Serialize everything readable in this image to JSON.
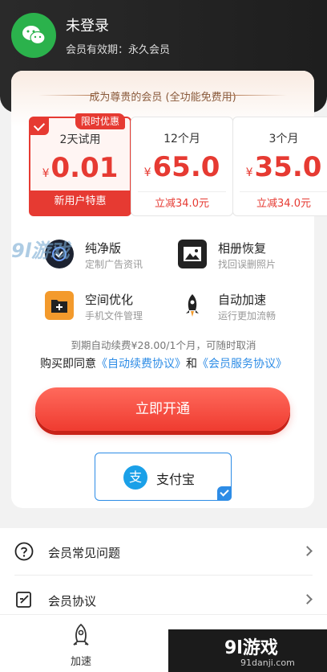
{
  "header": {
    "user_name": "未登录",
    "membership": "会员有效期：永久会员"
  },
  "card": {
    "title": "成为尊贵的会员 (全功能免费用)"
  },
  "plans": [
    {
      "name": "2天试用",
      "currency": "¥",
      "price": "0.01",
      "foot": "新用户特惠",
      "badge": "限时优惠",
      "selected": true
    },
    {
      "name": "12个月",
      "currency": "¥",
      "price": "65.0",
      "foot": "立减34.0元",
      "selected": false
    },
    {
      "name": "3个月",
      "currency": "¥",
      "price": "35.0",
      "foot": "立减34.0元",
      "selected": false
    }
  ],
  "features": [
    {
      "title": "纯净版",
      "desc": "定制广告资讯",
      "icon": "pure-icon"
    },
    {
      "title": "相册恢复",
      "desc": "找回误删照片",
      "icon": "photo-icon"
    },
    {
      "title": "空间优化",
      "desc": "手机文件管理",
      "icon": "folder-plus-icon"
    },
    {
      "title": "自动加速",
      "desc": "运行更加流畅",
      "icon": "rocket-icon"
    }
  ],
  "renew": {
    "line1": "到期自动续费¥28.00/1个月，可随时取消",
    "prefix": "购买即同意",
    "link1": "《自动续费协议》",
    "and": "和",
    "link2": "《会员服务协议》"
  },
  "open_button": "立即开通",
  "payment": {
    "label": "支付宝",
    "logo_char": "支"
  },
  "list": [
    {
      "label": "会员常见问题",
      "icon": "question-icon"
    },
    {
      "label": "会员协议",
      "icon": "edit-doc-icon"
    }
  ],
  "tabbar": {
    "label": "加速"
  },
  "watermark": {
    "brand": "9l游戏",
    "url": "91danji.com",
    "left_mark": "9l游戏"
  },
  "colors": {
    "accent": "#e63a32",
    "link": "#2d8ce6",
    "wechat_green": "#2bb24c"
  }
}
